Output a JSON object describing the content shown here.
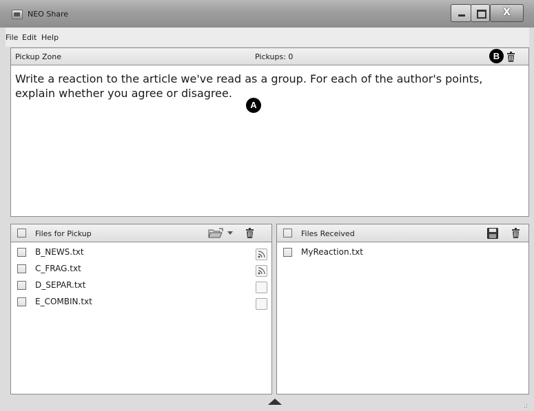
{
  "window": {
    "title": "NEO Share",
    "close_label": "X"
  },
  "menu": {
    "items": [
      "File",
      "Edit",
      "Help"
    ]
  },
  "pickup": {
    "zone_label": "Pickup Zone",
    "count_label": "Pickups: 0",
    "marker_b": "B",
    "prompt": "Write a reaction to the article we've read as a group. For each of the author's points, explain whether you agree or disagree.",
    "marker_a": "A"
  },
  "files_for_pickup": {
    "header": "Files for Pickup",
    "files": [
      {
        "name": "B_NEWS.txt",
        "sent": true
      },
      {
        "name": "C_FRAG.txt",
        "sent": true
      },
      {
        "name": "D_SEPAR.txt",
        "sent": false
      },
      {
        "name": "E_COMBIN.txt",
        "sent": false
      }
    ]
  },
  "files_received": {
    "header": "Files Received",
    "files": [
      {
        "name": "MyReaction.txt"
      }
    ]
  },
  "colors": {
    "titlebar": "#9d9d9d",
    "panel_header": "#e6e6e6",
    "marker": "#000000"
  }
}
